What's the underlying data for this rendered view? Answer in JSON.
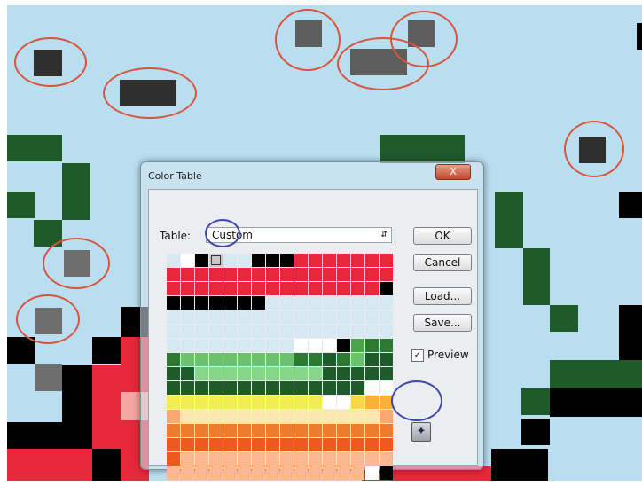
{
  "dialog": {
    "title": "Color Table",
    "close_label": "X",
    "table_label": "Table:",
    "table_value": "Custom",
    "buttons": {
      "ok": "OK",
      "cancel": "Cancel",
      "load": "Load...",
      "save": "Save..."
    },
    "preview_label": "Preview",
    "preview_checked": true,
    "swatch_rows": [
      [
        "#d6e8f2",
        "#ffffff",
        "#000000",
        "#c9c9c9",
        "#d6e8f2",
        "#d6e8f2",
        "#000000",
        "#000000",
        "#000000",
        "#e8283a",
        "#e8283a",
        "#e8283a",
        "#e8283a",
        "#e8283a",
        "#e8283a",
        "#e8283a"
      ],
      [
        "#e8283a",
        "#e8283a",
        "#e8283a",
        "#e8283a",
        "#e8283a",
        "#e8283a",
        "#e8283a",
        "#e8283a",
        "#e8283a",
        "#e8283a",
        "#e8283a",
        "#e8283a",
        "#e8283a",
        "#e8283a",
        "#e8283a",
        "#e8283a"
      ],
      [
        "#e8283a",
        "#e8283a",
        "#e8283a",
        "#e8283a",
        "#e8283a",
        "#e8283a",
        "#e8283a",
        "#e8283a",
        "#e8283a",
        "#e8283a",
        "#e8283a",
        "#e8283a",
        "#e8283a",
        "#e8283a",
        "#e8283a",
        "#000000"
      ],
      [
        "#000000",
        "#000000",
        "#000000",
        "#000000",
        "#000000",
        "#000000",
        "#000000",
        "#d6e8f2",
        "#d6e8f2",
        "#d6e8f2",
        "#d6e8f2",
        "#d6e8f2",
        "#d6e8f2",
        "#d6e8f2",
        "#d6e8f2",
        "#d6e8f2"
      ],
      [
        "#d6e8f2",
        "#d6e8f2",
        "#d6e8f2",
        "#d6e8f2",
        "#d6e8f2",
        "#d6e8f2",
        "#d6e8f2",
        "#d6e8f2",
        "#d6e8f2",
        "#d6e8f2",
        "#d6e8f2",
        "#d6e8f2",
        "#d6e8f2",
        "#d6e8f2",
        "#d6e8f2",
        "#d6e8f2"
      ],
      [
        "#d6e8f2",
        "#d6e8f2",
        "#d6e8f2",
        "#d6e8f2",
        "#d6e8f2",
        "#d6e8f2",
        "#d6e8f2",
        "#d6e8f2",
        "#d6e8f2",
        "#d6e8f2",
        "#d6e8f2",
        "#d6e8f2",
        "#d6e8f2",
        "#d6e8f2",
        "#d6e8f2",
        "#d6e8f2"
      ],
      [
        "#d6e8f2",
        "#d6e8f2",
        "#d6e8f2",
        "#d6e8f2",
        "#d6e8f2",
        "#d6e8f2",
        "#d6e8f2",
        "#d6e8f2",
        "#d6e8f2",
        "#ffffff",
        "#ffffff",
        "#ffffff",
        "#000000",
        "#4aa54a",
        "#2c7a32",
        "#2c7a32"
      ],
      [
        "#2c7a32",
        "#6cc26c",
        "#6cc26c",
        "#6cc26c",
        "#6cc26c",
        "#6cc26c",
        "#6cc26c",
        "#6cc26c",
        "#6cc26c",
        "#2c7a32",
        "#2c7a32",
        "#1e5a2a",
        "#2c7a32",
        "#6cc26c",
        "#1e5a2a",
        "#1e5a2a"
      ],
      [
        "#1e5a2a",
        "#1e5a2a",
        "#8bd48b",
        "#8bd48b",
        "#8bd48b",
        "#8bd48b",
        "#8bd48b",
        "#8bd48b",
        "#8bd48b",
        "#8bd48b",
        "#8bd48b",
        "#1e5a2a",
        "#1e5a2a",
        "#1e5a2a",
        "#1e5a2a",
        "#1e5a2a"
      ],
      [
        "#1e5a2a",
        "#1e5a2a",
        "#1e5a2a",
        "#1e5a2a",
        "#1e5a2a",
        "#1e5a2a",
        "#1e5a2a",
        "#1e5a2a",
        "#1e5a2a",
        "#1e5a2a",
        "#1e5a2a",
        "#1e5a2a",
        "#1e5a2a",
        "#1e5a2a",
        "#ffffff",
        "#ffffff"
      ],
      [
        "#f4ec54",
        "#f4ec54",
        "#f4ec54",
        "#f4ec54",
        "#f4ec54",
        "#f4ec54",
        "#f4ec54",
        "#f4ec54",
        "#f4ec54",
        "#f4ec54",
        "#f4ec54",
        "#ffffff",
        "#ffffff",
        "#fbd64a",
        "#f9b13a",
        "#f9b13a"
      ],
      [
        "#f9a870",
        "#fbe8b0",
        "#fbe8b0",
        "#fbe8b0",
        "#fbe8b0",
        "#fbe8b0",
        "#fbe8b0",
        "#fbe8b0",
        "#fbe8b0",
        "#fbe8b0",
        "#fbe8b0",
        "#fbe8b0",
        "#fbe8b0",
        "#fbe8b0",
        "#fbe8b0",
        "#f9a870"
      ],
      [
        "#f07b2c",
        "#f07b2c",
        "#f07b2c",
        "#f07b2c",
        "#f07b2c",
        "#f07b2c",
        "#f07b2c",
        "#f07b2c",
        "#f07b2c",
        "#f07b2c",
        "#f07b2c",
        "#f07b2c",
        "#f07b2c",
        "#f07b2c",
        "#f07b2c",
        "#f07b2c"
      ],
      [
        "#ec5a1e",
        "#ec5a1e",
        "#ec5a1e",
        "#ec5a1e",
        "#ec5a1e",
        "#ec5a1e",
        "#ec5a1e",
        "#ec5a1e",
        "#ec5a1e",
        "#ec5a1e",
        "#ec5a1e",
        "#ec5a1e",
        "#ec5a1e",
        "#ec5a1e",
        "#ec5a1e",
        "#ec5a1e"
      ],
      [
        "#ec5a1e",
        "#fbb892",
        "#fbb892",
        "#fbb892",
        "#fbb892",
        "#fbb892",
        "#fbb892",
        "#fbb892",
        "#fbb892",
        "#fbb892",
        "#fbb892",
        "#fbb892",
        "#fbb892",
        "#fbb892",
        "#fbb892",
        "#fbb892"
      ],
      [
        "#fbb892",
        "#fbb892",
        "#fbb892",
        "#fbb892",
        "#fbb892",
        "#fbb892",
        "#fbb892",
        "#fbb892",
        "#fbb892",
        "#fbb892",
        "#fbb892",
        "#fbb892",
        "#fbb892",
        "#fbb892",
        "#ffffff",
        "#000000"
      ]
    ]
  },
  "colors": {
    "sky": "#b8def0",
    "dark_green": "#1f5a2b",
    "gray_dark": "#333333",
    "gray_mid": "#5d5d5d",
    "gray_light": "#7a7a7a",
    "red": "#e8283a",
    "black": "#000000",
    "annotation_red": "#d9543c",
    "annotation_blue": "#3d49a8"
  }
}
